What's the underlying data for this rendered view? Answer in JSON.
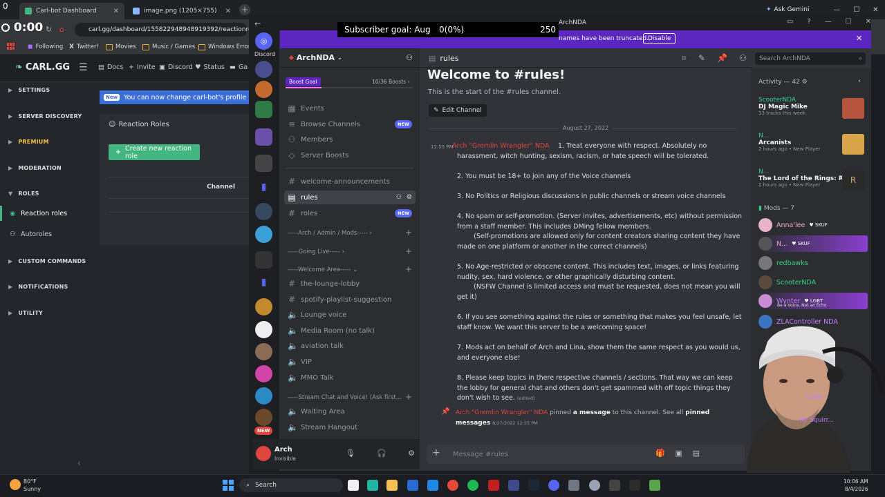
{
  "browser": {
    "tabs": [
      {
        "title": "Carl-bot Dashboard",
        "active": true
      },
      {
        "title": "image.png (1205×755)",
        "active": false
      }
    ],
    "url": "carl.gg/dashboard/155822948948919392/reactionroles",
    "ask_gemini": "Ask Gemini",
    "bookmarks": [
      "Following",
      "Twitter!",
      "Movies",
      "Music / Games",
      "Windows Error"
    ],
    "overlay_timer": "0:00",
    "overlay_small": "0"
  },
  "carl": {
    "logo": "CARL.GG",
    "nav": [
      "Docs",
      "Invite",
      "Discord",
      "Status",
      "Ga"
    ],
    "sections": [
      "SETTINGS",
      "SERVER DISCOVERY",
      "PREMIUM",
      "MODERATION",
      "ROLES",
      "CUSTOM COMMANDS",
      "NOTIFICATIONS",
      "UTILITY"
    ],
    "roles_items": [
      "Reaction roles",
      "Autoroles"
    ],
    "banner_pill": "New",
    "banner_text": "You can now change carl-bot's profile picture a",
    "panel_title": "Reaction Roles",
    "create_button": "Create new reaction role",
    "table_header": "Channel"
  },
  "discord": {
    "app": "Discord",
    "title_server": "ArchNDA",
    "subscriber_goal": {
      "label": "Subscriber goal: Aug",
      "progress": "0(0%)",
      "target": "250"
    },
    "truncated_notice": "names have been truncated.",
    "disable_button": "Disable",
    "server_name": "ArchNDA",
    "boost_goal": "Boost Goal",
    "boosts": "10/36 Boosts",
    "top_items": [
      {
        "label": "Events",
        "badge": ""
      },
      {
        "label": "Browse Channels",
        "badge": "NEW"
      },
      {
        "label": "Members",
        "badge": ""
      },
      {
        "label": "Server Boosts",
        "badge": ""
      }
    ],
    "channels_a": [
      {
        "label": "welcome-announcements",
        "badge": ""
      },
      {
        "label": "rules",
        "badge": ""
      },
      {
        "label": "roles",
        "badge": "NEW"
      }
    ],
    "categories": [
      "-----Arch / Admin / Mods-----",
      "-----Going Live-----",
      "-----Welcome Area-----"
    ],
    "channels_b": [
      "the-lounge-lobby",
      "spotify-playlist-suggestion"
    ],
    "voice": [
      "Lounge voice",
      "Media Room (no talk)",
      "aviation talk",
      "VIP",
      "MMO Talk"
    ],
    "stream_cat": "-----Stream Chat and Voice! (Ask first...",
    "voice_b": [
      "Waiting Area",
      "Stream Hangout"
    ],
    "new_server_badge": "NEW",
    "user": {
      "name": "Arch",
      "status": "Invisible"
    },
    "channel_name": "rules",
    "search_placeholder": "Search ArchNDA",
    "welcome_title": "Welcome to #rules!",
    "welcome_sub": "This is the start of the #rules channel.",
    "edit_channel": "Edit Channel",
    "date_divider": "August 27, 2022",
    "message": {
      "time": "12:55 PM",
      "author": "Arch \"Gremlin Wrangler\" NDA",
      "lines": [
        "1.  Treat everyone with respect.  Absolutely no",
        "harassment, witch hunting, sexism, racism, or  hate speech will be tolerated.",
        "",
        "2. You must be 18+ to join any of the Voice channels",
        "",
        "3. No Politics or Religious discussions in public channels or stream voice channels",
        "",
        "4. No spam or self-promotion. (Server invites, advertisements, etc) without permission",
        "from a staff member.  This includes DMing fellow members.",
        "        (Self-promotions are allowed only for content creators sharing content they have",
        "made on one platform or another in the correct channels)",
        "",
        "5. No Age-restricted or obscene content.  This includes text, images, or links featuring",
        "nudity, sex, hard violence, or other graphically disturbing content.",
        "        (NSFW Channel is limited access and must be requested, does not mean you will",
        "get it)",
        "",
        "6. If you see something against the rules or something that makes you feel unsafe, let",
        "staff know.  We want this server to be a welcoming space!",
        "",
        "7. Mods act on behalf of Arch and Lina, show them the same respect as you would us,",
        "and everyone else!",
        "",
        "8. Please keep topics in there respective channels / sections.  That way we can keep",
        "the lobby for general chat and others don't get spammed with off topic things they",
        "don't wish to see."
      ],
      "edited": "(edited)"
    },
    "pin": {
      "author": "Arch \"Gremlin Wrangler\" NDA",
      "pinned": "pinned",
      "a_message": "a message",
      "rest": "to this channel. See all",
      "pinned_messages": "pinned messages",
      "time": "8/27/2022 12:55 PM"
    },
    "composer_placeholder": "Message #rules",
    "activity": {
      "label": "Activity — 42",
      "items": [
        {
          "name": "ScooterNDA",
          "title": "DJ Magic Mike",
          "sub": "13 tracks this week"
        },
        {
          "name": "N...",
          "title": "Arcanists",
          "sub": "2 hours ago • New Player"
        },
        {
          "name": "N...",
          "title": "The Lord of the Rings: Retu...",
          "sub": "2 hours ago • New Player"
        }
      ]
    },
    "mods_label": "Mods — 7",
    "mods": [
      {
        "name": "Anna'lee",
        "tag": "SKUF",
        "color": "#f0a8d0"
      },
      {
        "name": "N...",
        "tag": "SKUF",
        "color": "#f0a8d0"
      },
      {
        "name": "redbawks",
        "tag": "",
        "color": "#3ad089"
      },
      {
        "name": "ScooterNDA",
        "tag": "",
        "color": "#3ad089"
      },
      {
        "name": "Wynter",
        "tag": "LGBT",
        "color": "#c77dff"
      },
      {
        "name": "ZLAController NDA",
        "tag": "",
        "color": "#c77dff"
      }
    ],
    "partial": [
      "Cudix",
      "Mr Squirr..."
    ],
    "partial_sub": "Be a Voice, Not an Echo"
  },
  "taskbar": {
    "weather_temp": "80°F",
    "weather_text": "Sunny",
    "search": "Search",
    "time": "10:06 AM",
    "date": "8/4/2026"
  }
}
